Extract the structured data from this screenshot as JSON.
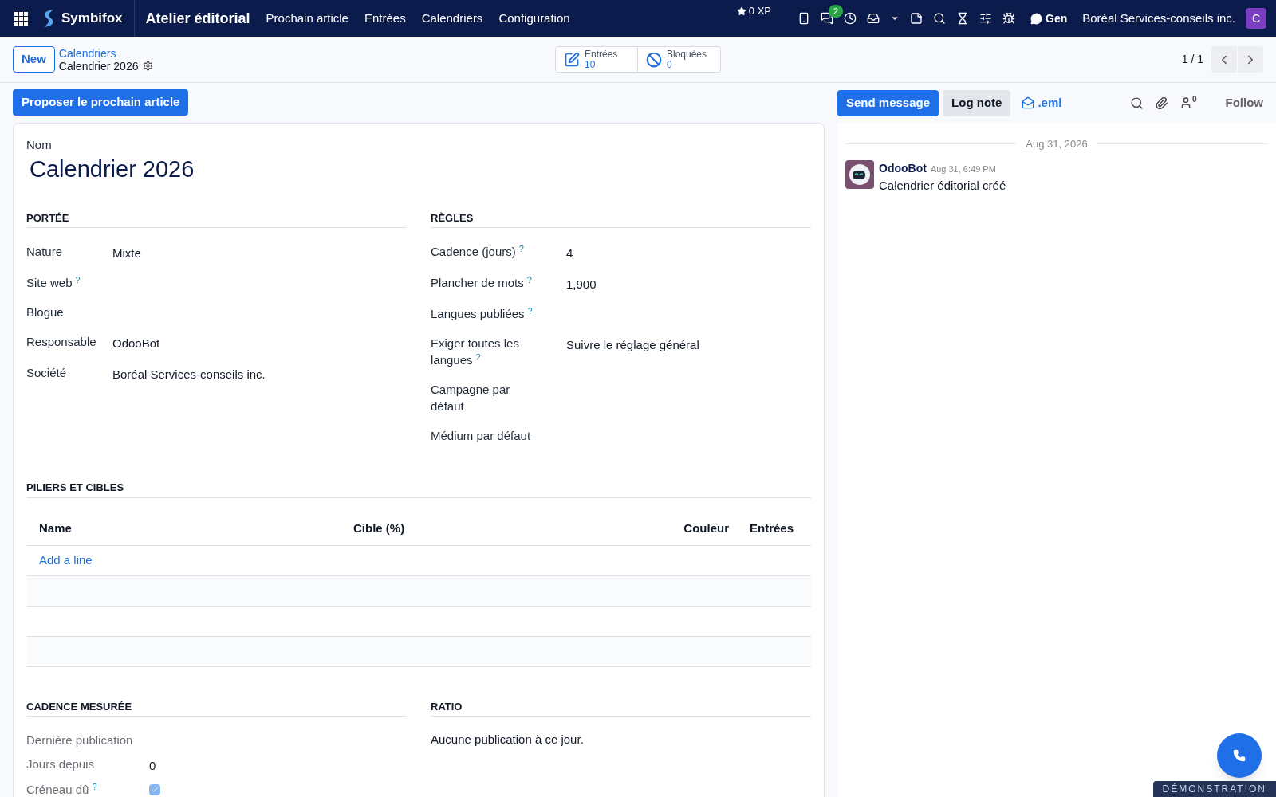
{
  "navbar": {
    "brand": "Symbifox",
    "module": "Atelier éditorial",
    "menu": [
      "Prochain article",
      "Entrées",
      "Calendriers",
      "Configuration"
    ],
    "xp": "0 XP",
    "messages_badge": "2",
    "chat": "Gen",
    "company": "Boréal Services-conseils inc.",
    "avatar": "C"
  },
  "control_panel": {
    "new_button": "New",
    "breadcrumb_parent": "Calendriers",
    "breadcrumb_current": "Calendrier 2026",
    "smart_buttons": [
      {
        "kind": "edit",
        "label": "Entrées",
        "value": "10"
      },
      {
        "kind": "blocked",
        "label": "Bloquées",
        "value": "0"
      }
    ],
    "pager": "1 / 1"
  },
  "action_button": "Proposer le prochain article",
  "form": {
    "name_label": "Nom",
    "name": "Calendrier 2026",
    "portee": {
      "title": "PORTÉE",
      "fields": [
        {
          "label": "Nature",
          "value": "Mixte"
        },
        {
          "label": "Site web",
          "help": "?"
        },
        {
          "label": "Blogue"
        },
        {
          "label": "Responsable",
          "value": "OdooBot"
        },
        {
          "label": "Société",
          "value": "Boréal Services-conseils inc."
        }
      ]
    },
    "regles": {
      "title": "RÈGLES",
      "fields": [
        {
          "label": "Cadence (jours)",
          "help": "?",
          "value": "4"
        },
        {
          "label": "Plancher de mots",
          "help": "?",
          "value": "1,900"
        },
        {
          "label": "Langues publiées",
          "help": "?"
        },
        {
          "label": "Exiger toutes les langues",
          "help": "?",
          "value": "Suivre le réglage général"
        },
        {
          "label": "Campagne par défaut"
        },
        {
          "label": "Médium par défaut"
        }
      ]
    },
    "piliers": {
      "title": "PILIERS ET CIBLES",
      "columns": [
        "Name",
        "Cible (%)",
        "Couleur",
        "Entrées"
      ],
      "add_line": "Add a line"
    },
    "cadence": {
      "title": "CADENCE MESURÉE",
      "fields": [
        {
          "kind": "text",
          "label": "Dernière publication"
        },
        {
          "kind": "text",
          "label": "Jours depuis",
          "value": "0"
        },
        {
          "kind": "checkbox",
          "label": "Créneau dû",
          "help": "?",
          "checked": true
        }
      ]
    },
    "ratio": {
      "title": "RATIO",
      "text": "Aucune publication à ce jour."
    }
  },
  "chatter": {
    "send": "Send message",
    "log": "Log note",
    "eml": ".eml",
    "followers": "0",
    "follow": "Follow",
    "date": "Aug 31, 2026",
    "messages": [
      {
        "author": "OdooBot",
        "time": "Aug 31, 6:49 PM",
        "body": "Calendrier éditorial créé"
      }
    ]
  },
  "ribbon": "DÉMONSTRATION"
}
